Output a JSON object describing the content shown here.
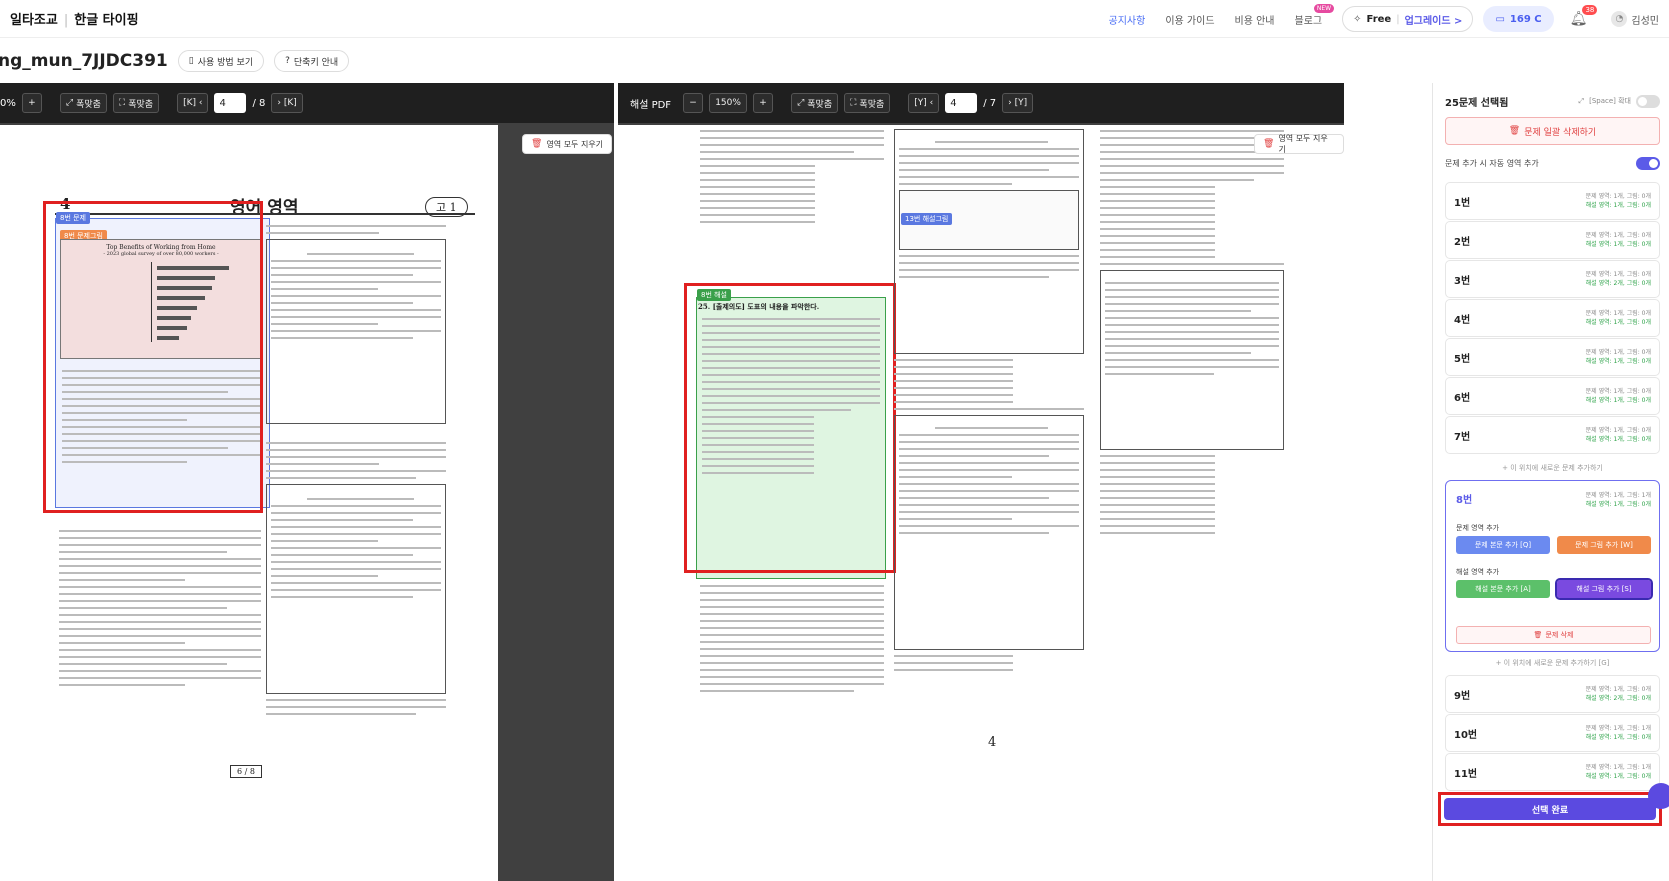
{
  "header": {
    "brand": "일타조교",
    "product": "한글 타이핑",
    "nav": [
      "공지사항",
      "이용 가이드",
      "비용 안내",
      "블로그"
    ],
    "new_badge": "NEW",
    "plan_label": "Free",
    "upgrade_label": "업그레이드 >",
    "credits": "169 C",
    "notif_count": "38",
    "user_name": "김성민"
  },
  "subbar": {
    "doc_title": "ng_mun_7JJDC391",
    "usage_label": "사용 방법 보기",
    "shortcut_label": "단축키 안내"
  },
  "left_viewer": {
    "zoom": "0%",
    "fit_width": "폭맞춤",
    "fit_page": "폭맞춤",
    "page_current": "4",
    "page_total": "/ 8",
    "clear_regions": "영역 모두 지우기",
    "page_header_num": "4",
    "page_header_title": "영어 영역",
    "page_header_grade": "고 1",
    "region_tag_problem": "8번 문제",
    "region_tag_figure": "8번 문제그림",
    "chart_title": "Top Benefits of Working from Home",
    "chart_subtitle": "- 2023 global survey of over 80,000 workers -",
    "footer_page": "6 / 8"
  },
  "right_viewer": {
    "label": "해설 PDF",
    "zoom": "150%",
    "fit_width": "폭맞춤",
    "fit_page": "폭맞춤",
    "page_current": "4",
    "page_total": "/ 7",
    "clear_regions": "영역 모두 지우기",
    "region_tag": "8번 해설",
    "side_tag": "13번 해설그림",
    "heading_line": "25. [출제의도] 도표의 내용을 파악한다.",
    "page_number": "4"
  },
  "sidebar": {
    "selected_title": "25문제 선택됨",
    "expand_label": "[Space] 확대",
    "bulk_delete": "문제 일괄 삭제하기",
    "auto_area_label": "문제 추가 시 자동 영역 추가",
    "items": [
      {
        "num": "1번",
        "m1": "문제 영역: 1개, 그림: 0개",
        "m2": "해설 영역: 1개, 그림: 0개"
      },
      {
        "num": "2번",
        "m1": "문제 영역: 1개, 그림: 0개",
        "m2": "해설 영역: 1개, 그림: 0개"
      },
      {
        "num": "3번",
        "m1": "문제 영역: 1개, 그림: 0개",
        "m2": "해설 영역: 2개, 그림: 0개"
      },
      {
        "num": "4번",
        "m1": "문제 영역: 1개, 그림: 0개",
        "m2": "해설 영역: 1개, 그림: 0개"
      },
      {
        "num": "5번",
        "m1": "문제 영역: 1개, 그림: 0개",
        "m2": "해설 영역: 1개, 그림: 0개"
      },
      {
        "num": "6번",
        "m1": "문제 영역: 1개, 그림: 0개",
        "m2": "해설 영역: 1개, 그림: 0개"
      },
      {
        "num": "7번",
        "m1": "문제 영역: 1개, 그림: 0개",
        "m2": "해설 영역: 1개, 그림: 0개"
      }
    ],
    "add_above_hint": "+ 이 위치에 새로운 문제 추가하기",
    "selected_item": {
      "num": "8번",
      "m1": "문제 영역: 1개, 그림: 1개",
      "m2": "해설 영역: 1개, 그림: 0개",
      "problem_area_label": "문제 영역 추가",
      "btn_problem_text": "문제 본문 추가 [Q]",
      "btn_problem_figure": "문제 그림 추가 [W]",
      "solution_area_label": "해설 영역 추가",
      "btn_solution_text": "해설 본문 추가 [A]",
      "btn_solution_figure": "해설 그림 추가 [S]",
      "delete_label": "문제 삭제"
    },
    "add_below_hint": "+ 이 위치에 새로운 문제 추가하기 [G]",
    "items_after": [
      {
        "num": "9번",
        "m1": "문제 영역: 1개, 그림: 0개",
        "m2": "해설 영역: 2개, 그림: 0개"
      },
      {
        "num": "10번",
        "m1": "문제 영역: 1개, 그림: 1개",
        "m2": "해설 영역: 1개, 그림: 0개"
      },
      {
        "num": "11번",
        "m1": "문제 영역: 1개, 그림: 1개",
        "m2": "해설 영역: 1개, 그림: 0개"
      }
    ],
    "done_label": "선택 완료"
  },
  "colors": {
    "accent": "#5b4ae0",
    "highlight_red": "#e02020",
    "problem_text_btn": "#6b8af0",
    "problem_figure_btn": "#f08a4a",
    "solution_text_btn": "#5cc06a",
    "solution_figure_btn": "#7a4ae0"
  }
}
